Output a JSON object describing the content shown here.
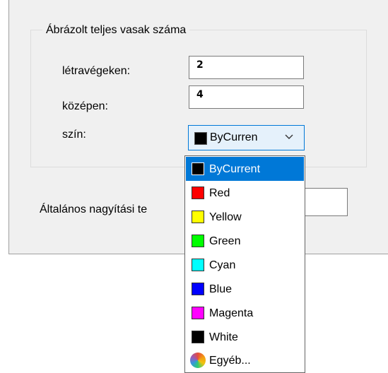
{
  "group": {
    "title": "Ábrázolt teljes vasak száma",
    "ends_label": "létravégeken:",
    "ends_value": "2",
    "middle_label": "középen:",
    "middle_value": "4",
    "color_label": "szín:"
  },
  "combo": {
    "selected": "ByCurren",
    "swatch_color": "#000000"
  },
  "scale": {
    "label": "Általános nagyítási te"
  },
  "color_options": [
    {
      "label": "ByCurrent",
      "color": "#000000",
      "selected": true
    },
    {
      "label": "Red",
      "color": "#ff0000"
    },
    {
      "label": "Yellow",
      "color": "#ffff00"
    },
    {
      "label": "Green",
      "color": "#00ff00"
    },
    {
      "label": "Cyan",
      "color": "#00ffff"
    },
    {
      "label": "Blue",
      "color": "#0000ff"
    },
    {
      "label": "Magenta",
      "color": "#ff00ff"
    },
    {
      "label": "White",
      "color": "#000000"
    },
    {
      "label": "Egyéb...",
      "icon": "color-wheel-icon"
    }
  ]
}
